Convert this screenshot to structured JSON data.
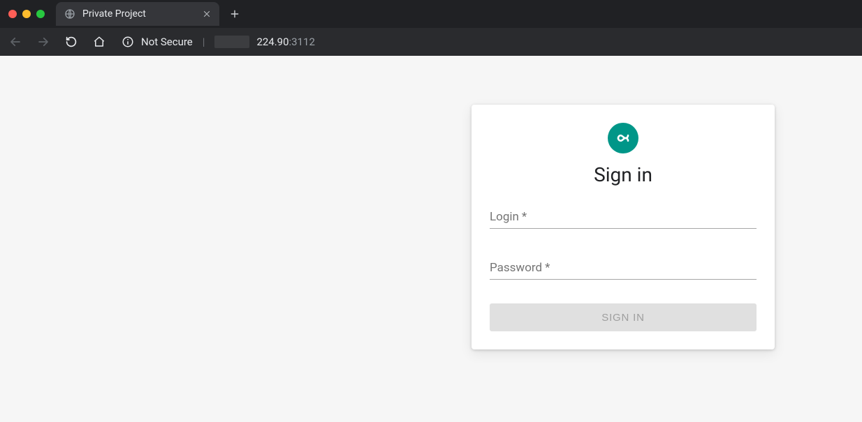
{
  "browser": {
    "tab_title": "Private Project",
    "security_label": "Not Secure",
    "url_host_visible": "224.90",
    "url_port": ":3112"
  },
  "auth": {
    "logo_color": "#009688",
    "heading": "Sign in",
    "login": {
      "label": "Login",
      "required_mark": "*",
      "value": ""
    },
    "password": {
      "label": "Password",
      "required_mark": "*",
      "value": ""
    },
    "submit_label": "SIGN IN"
  }
}
